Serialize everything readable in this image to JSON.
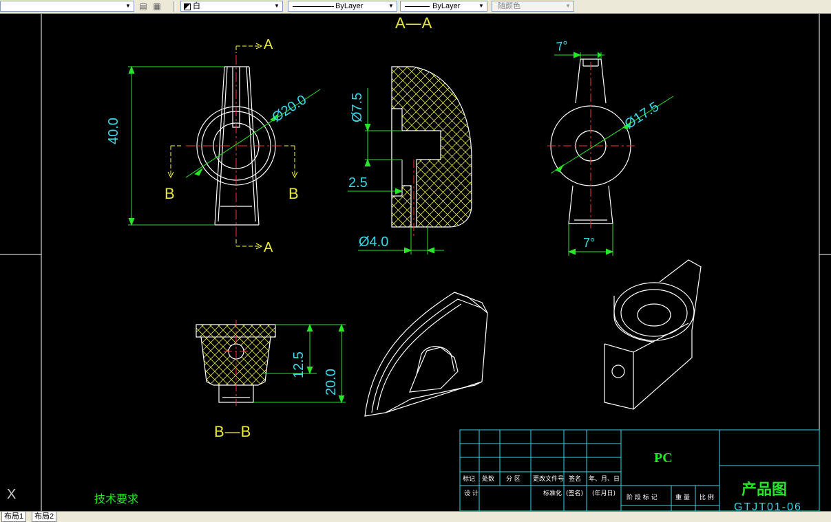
{
  "toolbar": {
    "layer_value": "白",
    "linetype_value": "ByLayer",
    "lineweight_value": "ByLayer",
    "plotstyle_value": "随颜色"
  },
  "drawing": {
    "section_aa": "A—A",
    "section_bb": "B—B",
    "label_a": "A",
    "label_b": "B",
    "dim_height_40": "40.0",
    "dim_dia_20": "Ø20.0",
    "dim_dia_7_5": "Ø7.5",
    "dim_2_5": "2.5",
    "dim_dia_4": "Ø4.0",
    "dim_angle_top": "7°",
    "dim_angle_bottom": "7°",
    "dim_dia_17_5": "Ø17.5",
    "dim_12_5": "12.5",
    "dim_20": "20.0",
    "tech_req": "技术要求",
    "ucs_x": "X"
  },
  "titleblock": {
    "material": "PC",
    "drawing_name": "产品图",
    "col_mark": "标记",
    "col_count": "处数",
    "col_zone": "分 区",
    "col_change_doc": "更改文件号",
    "col_sign": "签名",
    "col_date": "年、月、日",
    "row_design": "设 计",
    "row_standard": "标准化",
    "row_sign2": "(签名)",
    "row_date2": "(年月日)",
    "stage_labels": "阶 段 标 记",
    "weight_label": "重 量",
    "scale_label": "比 例",
    "drawing_no": "GTJT01-06"
  },
  "tabs": [
    "布局1",
    "布局2"
  ]
}
